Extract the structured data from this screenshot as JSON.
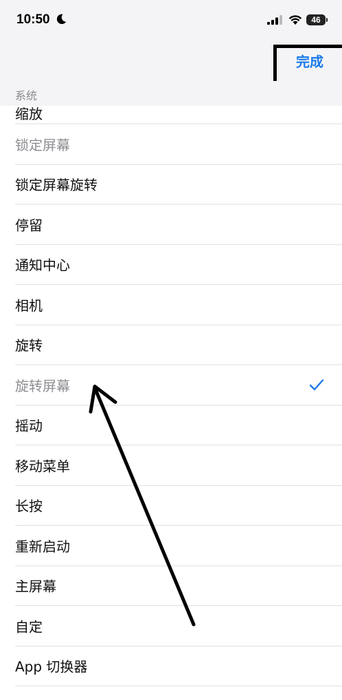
{
  "status_bar": {
    "time": "10:50",
    "battery": "46"
  },
  "nav": {
    "done_label": "完成"
  },
  "section": {
    "title": "系统"
  },
  "list": {
    "items": [
      {
        "label": "缩放",
        "style": "partial"
      },
      {
        "label": "锁定屏幕",
        "style": "dim"
      },
      {
        "label": "锁定屏幕旋转",
        "style": "normal"
      },
      {
        "label": "停留",
        "style": "normal"
      },
      {
        "label": "通知中心",
        "style": "normal"
      },
      {
        "label": "相机",
        "style": "normal"
      },
      {
        "label": "旋转",
        "style": "normal"
      },
      {
        "label": "旋转屏幕",
        "style": "dim",
        "checked": true
      },
      {
        "label": "摇动",
        "style": "normal"
      },
      {
        "label": "移动菜单",
        "style": "normal"
      },
      {
        "label": "长按",
        "style": "normal"
      },
      {
        "label": "重新启动",
        "style": "normal"
      },
      {
        "label": "主屏幕",
        "style": "normal"
      },
      {
        "label": "自定",
        "style": "normal"
      },
      {
        "label": "App 切换器",
        "style": "normal"
      }
    ]
  },
  "colors": {
    "accent": "#1a7ae8",
    "dim_text": "#8d8d92",
    "background": "#f4f4f6"
  },
  "icons": [
    "moon-icon",
    "signal-icon",
    "wifi-icon",
    "battery-icon",
    "checkmark-icon",
    "annotation-arrow"
  ]
}
